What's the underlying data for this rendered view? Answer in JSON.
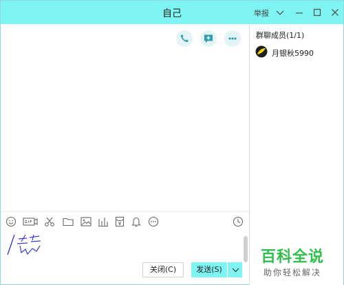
{
  "window": {
    "title": "自己",
    "report_label": "举报"
  },
  "members": {
    "title": "群聊成员(1/1)",
    "items": [
      {
        "name": "月银秋5990"
      }
    ]
  },
  "buttons": {
    "close_label": "关闭(C)",
    "send_label": "发送(S)"
  },
  "watermark": {
    "main": "百科全说",
    "sub": "助你轻松解决"
  },
  "colors": {
    "accent": "#7ff5f3",
    "icon": "#2a9fb0",
    "watermark_green": "#2fbf4d"
  }
}
